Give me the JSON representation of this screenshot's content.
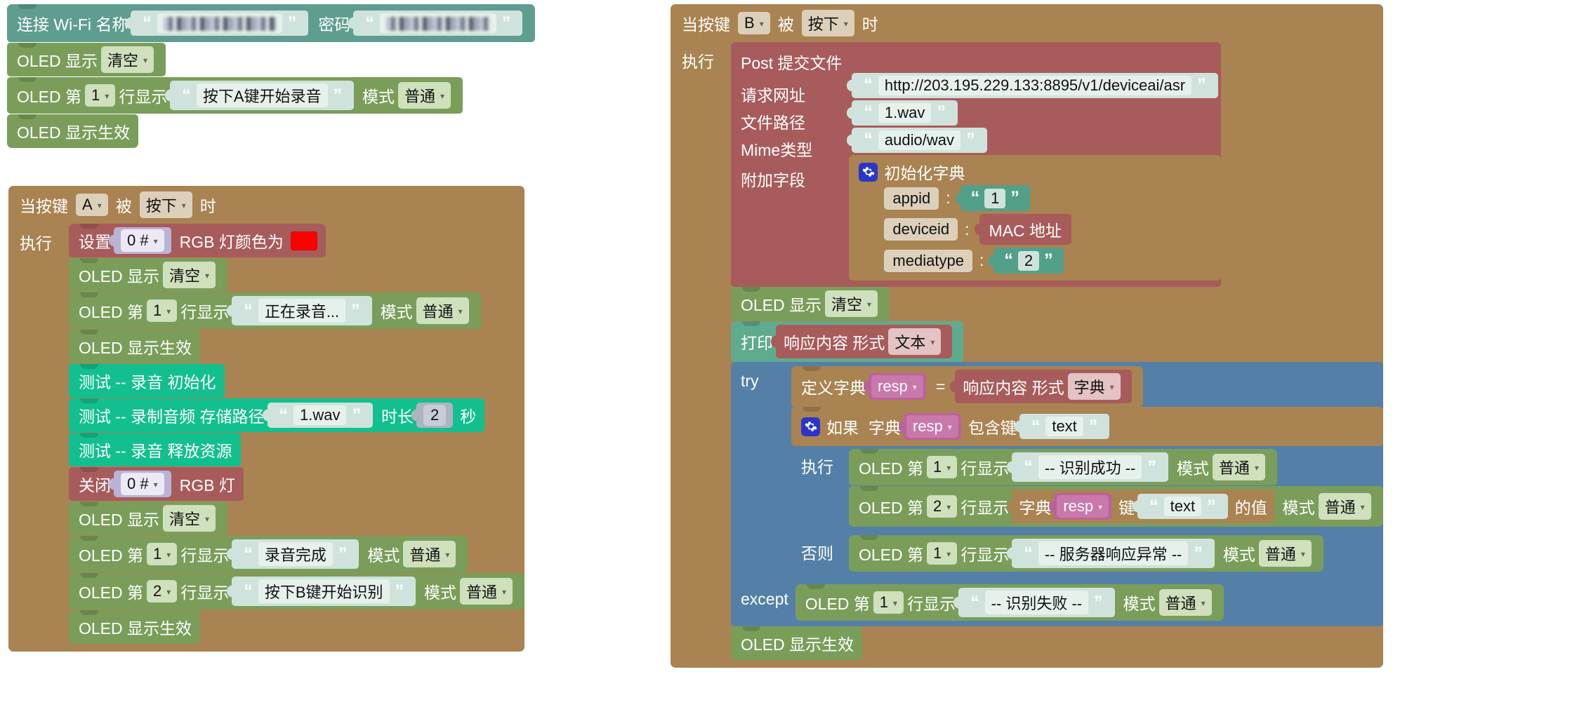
{
  "colors": {
    "wifi_block": "#5f9e8f",
    "oled_block": "#7a9e5a",
    "event_hat": "#a98351",
    "rgb_block": "#a85b5b",
    "test_block": "#12bf8e",
    "network_block": "#a85b5b",
    "dict_block": "#a98351",
    "print_block": "#5fab8e",
    "try_block": "#5480a8",
    "variable_block": "#b9639a",
    "rgb_swatch": "#ff0000"
  },
  "labels": {
    "oled": "OLED",
    "quote_open": "“",
    "quote_close": "”",
    "colon": ":",
    "equals": "=",
    "gear": "gear-icon",
    "caret": "▾"
  },
  "script_wifi": {
    "connect_wifi": {
      "label_name": "连接 Wi-Fi 名称",
      "ssid_value": "",
      "ssid_redacted": true,
      "label_password": "密码",
      "password_value": "",
      "password_redacted": true
    },
    "rows": [
      {
        "kind": "oled_clear",
        "prefix": "OLED 显示",
        "option": "清空"
      },
      {
        "kind": "oled_line",
        "prefix": "OLED 第",
        "line": "1",
        "mid": "行显示",
        "text": "按下A键开始录音",
        "mode_label": "模式",
        "mode": "普通"
      },
      {
        "kind": "oled_refresh",
        "text": "OLED 显示生效"
      }
    ]
  },
  "script_key_a": {
    "hat": {
      "prefix": "当按键",
      "key": "A",
      "mid": "被",
      "action": "按下",
      "suffix": "时",
      "do_label": "执行"
    },
    "rows": [
      {
        "kind": "rgb_set",
        "prefix": "设置",
        "index": "0 #",
        "mid": "RGB 灯颜色为",
        "color": "#ff0000"
      },
      {
        "kind": "oled_clear",
        "prefix": "OLED 显示",
        "option": "清空"
      },
      {
        "kind": "oled_line",
        "prefix": "OLED 第",
        "line": "1",
        "mid": "行显示",
        "text": "正在录音...",
        "mode_label": "模式",
        "mode": "普通"
      },
      {
        "kind": "oled_refresh",
        "text": "OLED 显示生效"
      },
      {
        "kind": "test",
        "text": "测试 -- 录音 初始化"
      },
      {
        "kind": "test_record",
        "prefix": "测试 -- 录制音频 存储路径",
        "path": "1.wav",
        "dur_label": "时长",
        "duration": "2",
        "unit": "秒"
      },
      {
        "kind": "test",
        "text": "测试 -- 录音 释放资源"
      },
      {
        "kind": "rgb_off",
        "prefix": "关闭",
        "index": "0 #",
        "mid": "RGB 灯"
      },
      {
        "kind": "oled_clear",
        "prefix": "OLED 显示",
        "option": "清空"
      },
      {
        "kind": "oled_line",
        "prefix": "OLED 第",
        "line": "1",
        "mid": "行显示",
        "text": "录音完成",
        "mode_label": "模式",
        "mode": "普通"
      },
      {
        "kind": "oled_line",
        "prefix": "OLED 第",
        "line": "2",
        "mid": "行显示",
        "text": "按下B键开始识别",
        "mode_label": "模式",
        "mode": "普通"
      },
      {
        "kind": "oled_refresh",
        "text": "OLED 显示生效"
      }
    ]
  },
  "script_key_b": {
    "hat": {
      "prefix": "当按键",
      "key": "B",
      "mid": "被",
      "action": "按下",
      "suffix": "时",
      "do_label": "执行"
    },
    "post": {
      "title": "Post 提交文件",
      "url_label": "请求网址",
      "url_value": "http://203.195.229.133:8895/v1/deviceai/asr",
      "file_label": "文件路径",
      "file_value": "1.wav",
      "mime_label": "Mime类型",
      "mime_value": "audio/wav",
      "extra_label": "附加字段",
      "dict_title": "初始化字典",
      "dict_entries": [
        {
          "key": "appid",
          "type": "text",
          "value": "1"
        },
        {
          "key": "deviceid",
          "type": "mac",
          "value": "MAC 地址"
        },
        {
          "key": "mediatype",
          "type": "text",
          "value": "2"
        }
      ]
    },
    "oled_clear": {
      "prefix": "OLED 显示",
      "option": "清空"
    },
    "print": {
      "label": "打印",
      "resp_label": "响应内容 形式",
      "resp_format": "文本"
    },
    "try": {
      "try_label": "try",
      "except_label": "except",
      "define_dict": {
        "prefix": "定义字典",
        "var": "resp",
        "equals": "=",
        "resp_label": "响应内容 形式",
        "resp_format": "字典"
      },
      "if": {
        "if_label": "如果",
        "dict_label": "字典",
        "var": "resp",
        "contains_label": "包含键",
        "key": "text",
        "do_label": "执行",
        "else_label": "否则"
      },
      "then_rows": [
        {
          "kind": "oled_line",
          "prefix": "OLED 第",
          "line": "1",
          "mid": "行显示",
          "text": "-- 识别成功 --",
          "mode_label": "模式",
          "mode": "普通"
        },
        {
          "kind": "oled_line_dict",
          "prefix": "OLED 第",
          "line": "2",
          "mid": "行显示",
          "dict_label": "字典",
          "var": "resp",
          "key_label": "键",
          "key": "text",
          "value_label": "的值",
          "mode_label": "模式",
          "mode": "普通"
        }
      ],
      "else_rows": [
        {
          "kind": "oled_line",
          "prefix": "OLED 第",
          "line": "1",
          "mid": "行显示",
          "text": "-- 服务器响应异常 --",
          "mode_label": "模式",
          "mode": "普通"
        }
      ],
      "except_rows": [
        {
          "kind": "oled_line",
          "prefix": "OLED 第",
          "line": "1",
          "mid": "行显示",
          "text": "-- 识别失败 --",
          "mode_label": "模式",
          "mode": "普通"
        }
      ]
    },
    "oled_refresh": "OLED 显示生效"
  }
}
